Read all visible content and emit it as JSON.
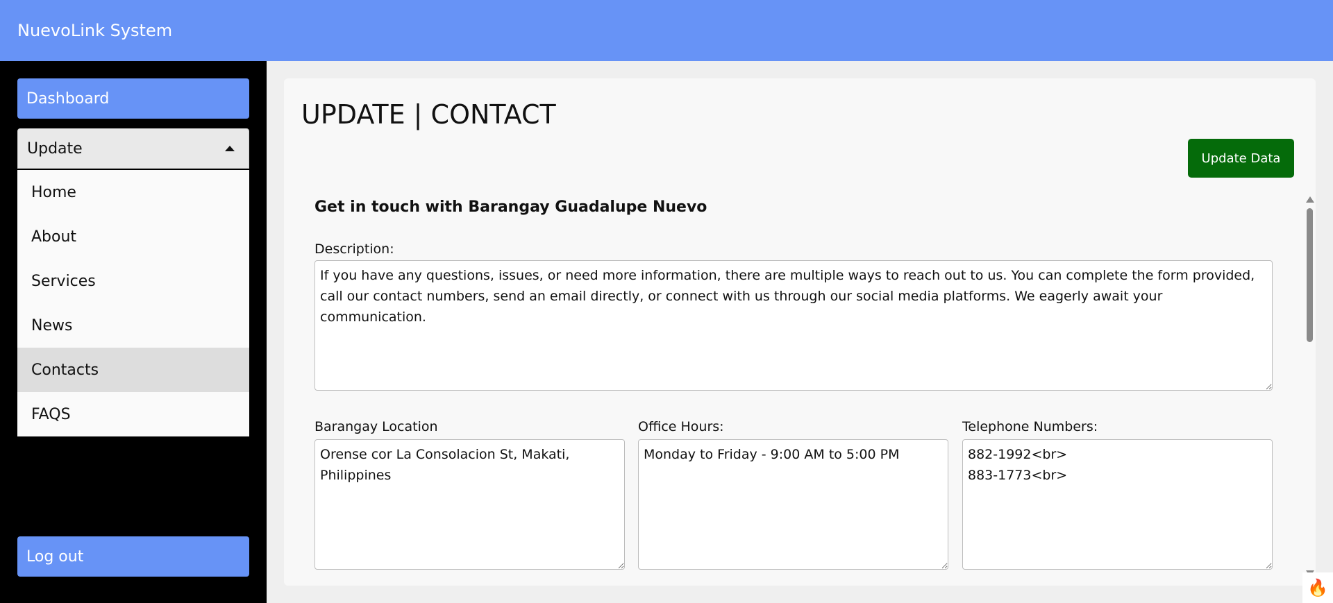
{
  "app": {
    "title": "NuevoLink System"
  },
  "sidebar": {
    "dashboard_label": "Dashboard",
    "update_label": "Update",
    "menu": [
      {
        "label": "Home"
      },
      {
        "label": "About"
      },
      {
        "label": "Services"
      },
      {
        "label": "News"
      },
      {
        "label": "Contacts"
      },
      {
        "label": "FAQS"
      }
    ],
    "active_item": "Contacts",
    "logout_label": "Log out"
  },
  "page": {
    "title": "UPDATE | CONTACT",
    "update_button": "Update Data",
    "section_heading": "Get in touch with Barangay Guadalupe Nuevo",
    "description": {
      "label": "Description:",
      "value": "If you have any questions, issues, or need more information, there are multiple ways to reach out to us. You can complete the form provided, call our contact numbers, send an email directly, or connect with us through our social media platforms. We eagerly await your communication."
    },
    "location": {
      "label": "Barangay Location",
      "value": "Orense cor La Consolacion St, Makati, Philippines"
    },
    "office_hours": {
      "label": "Office Hours:",
      "value": "Monday to Friday - 9:00 AM to 5:00 PM"
    },
    "telephone": {
      "label": "Telephone Numbers:",
      "value": "882-1992<br>\n883-1773<br>"
    }
  },
  "colors": {
    "topbar": "#6793f6",
    "update_button": "#056b0a",
    "sidebar": "#000000"
  }
}
